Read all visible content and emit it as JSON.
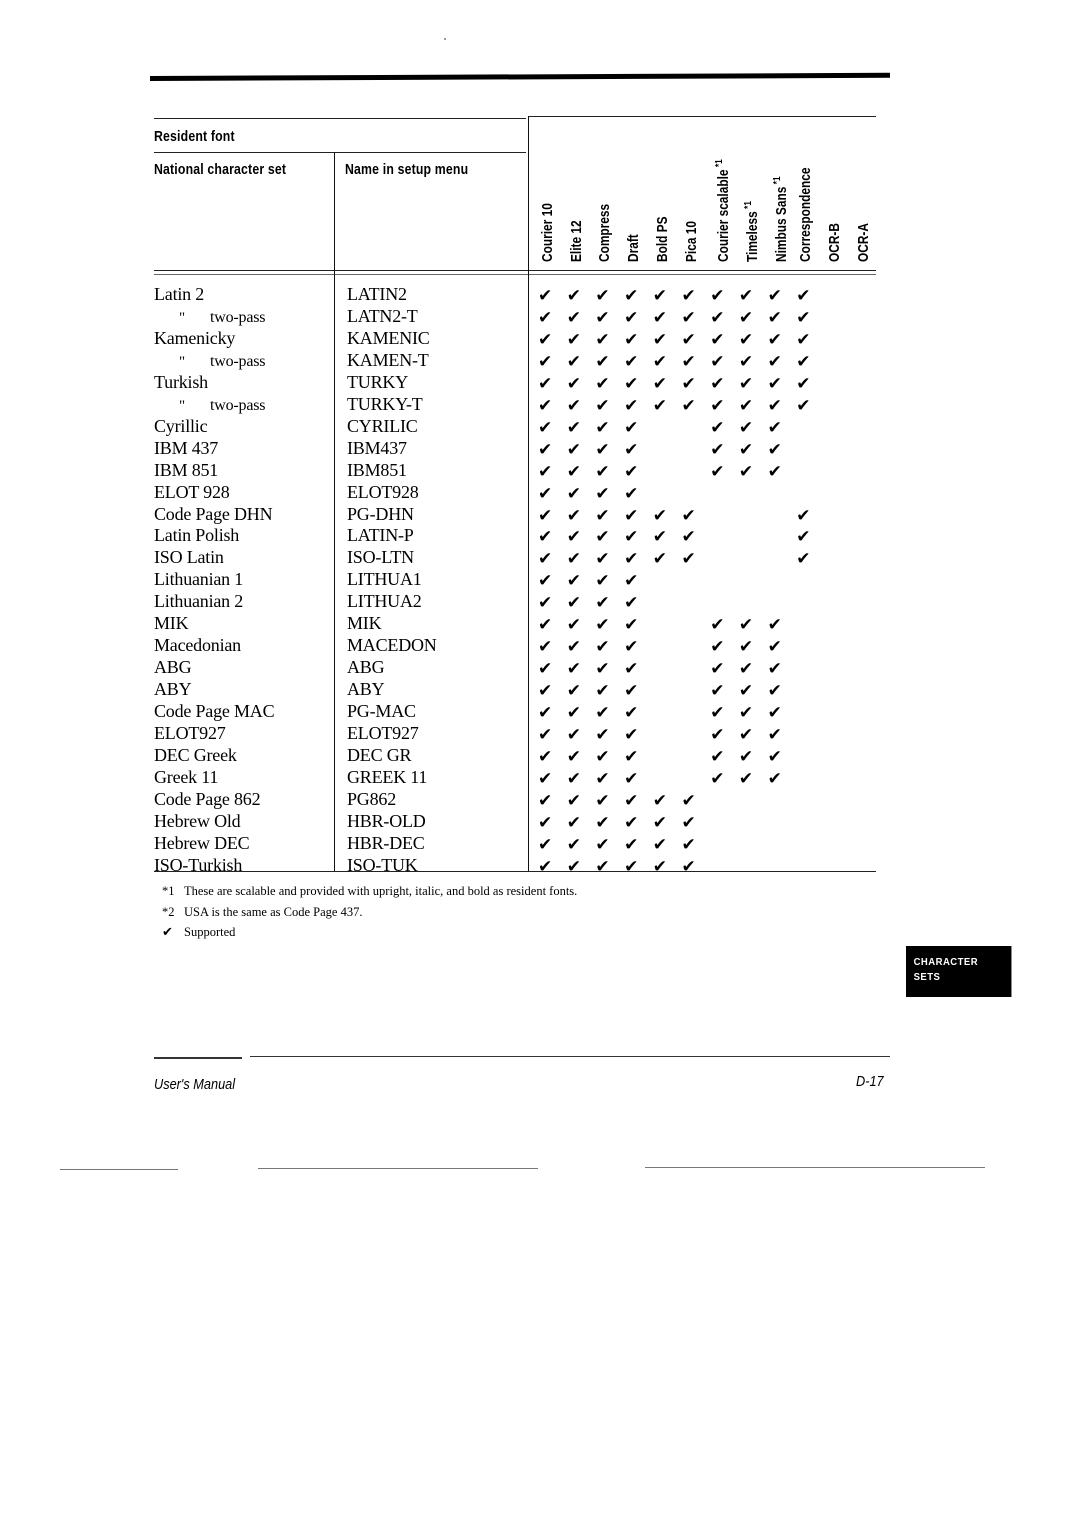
{
  "table": {
    "header_group": "Resident font",
    "col1_header": "National character set",
    "col2_header": "Name in setup menu",
    "font_columns": [
      {
        "label": "Courier 10",
        "note": ""
      },
      {
        "label": "Elite 12",
        "note": ""
      },
      {
        "label": "Compress",
        "note": ""
      },
      {
        "label": "Draft",
        "note": ""
      },
      {
        "label": "Bold PS",
        "note": ""
      },
      {
        "label": "Pica 10",
        "note": ""
      },
      {
        "label": "Courier scalable",
        "note": "*1"
      },
      {
        "label": "Timeless",
        "note": "*1"
      },
      {
        "label": "Nimbus Sans",
        "note": "*1"
      },
      {
        "label": "Correspondence",
        "note": ""
      },
      {
        "label": "OCR-B",
        "note": ""
      },
      {
        "label": "OCR-A",
        "note": ""
      }
    ],
    "rows": [
      {
        "name": "Latin 2",
        "ditto": false,
        "menu": "LATIN2",
        "support": [
          1,
          1,
          1,
          1,
          1,
          1,
          1,
          1,
          1,
          1,
          0,
          0
        ]
      },
      {
        "name": "two-pass",
        "ditto": true,
        "menu": "LATN2-T",
        "support": [
          1,
          1,
          1,
          1,
          1,
          1,
          1,
          1,
          1,
          1,
          0,
          0
        ]
      },
      {
        "name": "Kamenicky",
        "ditto": false,
        "menu": "KAMENIC",
        "support": [
          1,
          1,
          1,
          1,
          1,
          1,
          1,
          1,
          1,
          1,
          0,
          0
        ]
      },
      {
        "name": "two-pass",
        "ditto": true,
        "menu": "KAMEN-T",
        "support": [
          1,
          1,
          1,
          1,
          1,
          1,
          1,
          1,
          1,
          1,
          0,
          0
        ]
      },
      {
        "name": "Turkish",
        "ditto": false,
        "menu": "TURKY",
        "support": [
          1,
          1,
          1,
          1,
          1,
          1,
          1,
          1,
          1,
          1,
          0,
          0
        ]
      },
      {
        "name": "two-pass",
        "ditto": true,
        "menu": "TURKY-T",
        "support": [
          1,
          1,
          1,
          1,
          1,
          1,
          1,
          1,
          1,
          1,
          0,
          0
        ]
      },
      {
        "name": "Cyrillic",
        "ditto": false,
        "menu": "CYRILIC",
        "support": [
          1,
          1,
          1,
          1,
          0,
          0,
          1,
          1,
          1,
          0,
          0,
          0
        ]
      },
      {
        "name": "IBM 437",
        "ditto": false,
        "menu": "IBM437",
        "support": [
          1,
          1,
          1,
          1,
          0,
          0,
          1,
          1,
          1,
          0,
          0,
          0
        ]
      },
      {
        "name": "IBM 851",
        "ditto": false,
        "menu": "IBM851",
        "support": [
          1,
          1,
          1,
          1,
          0,
          0,
          1,
          1,
          1,
          0,
          0,
          0
        ]
      },
      {
        "name": "ELOT 928",
        "ditto": false,
        "menu": "ELOT928",
        "support": [
          1,
          1,
          1,
          1,
          0,
          0,
          0,
          0,
          0,
          0,
          0,
          0
        ]
      },
      {
        "name": "Code Page DHN",
        "ditto": false,
        "menu": "PG-DHN",
        "support": [
          1,
          1,
          1,
          1,
          1,
          1,
          0,
          0,
          0,
          1,
          0,
          0
        ]
      },
      {
        "name": "Latin Polish",
        "ditto": false,
        "menu": "LATIN-P",
        "support": [
          1,
          1,
          1,
          1,
          1,
          1,
          0,
          0,
          0,
          1,
          0,
          0
        ]
      },
      {
        "name": "ISO Latin",
        "ditto": false,
        "menu": "ISO-LTN",
        "support": [
          1,
          1,
          1,
          1,
          1,
          1,
          0,
          0,
          0,
          1,
          0,
          0
        ]
      },
      {
        "name": "Lithuanian 1",
        "ditto": false,
        "menu": "LITHUA1",
        "support": [
          1,
          1,
          1,
          1,
          0,
          0,
          0,
          0,
          0,
          0,
          0,
          0
        ]
      },
      {
        "name": "Lithuanian 2",
        "ditto": false,
        "menu": "LITHUA2",
        "support": [
          1,
          1,
          1,
          1,
          0,
          0,
          0,
          0,
          0,
          0,
          0,
          0
        ]
      },
      {
        "name": "MIK",
        "ditto": false,
        "menu": "MIK",
        "support": [
          1,
          1,
          1,
          1,
          0,
          0,
          1,
          1,
          1,
          0,
          0,
          0
        ]
      },
      {
        "name": "Macedonian",
        "ditto": false,
        "menu": "MACEDON",
        "support": [
          1,
          1,
          1,
          1,
          0,
          0,
          1,
          1,
          1,
          0,
          0,
          0
        ]
      },
      {
        "name": "ABG",
        "ditto": false,
        "menu": "ABG",
        "support": [
          1,
          1,
          1,
          1,
          0,
          0,
          1,
          1,
          1,
          0,
          0,
          0
        ]
      },
      {
        "name": "ABY",
        "ditto": false,
        "menu": "ABY",
        "support": [
          1,
          1,
          1,
          1,
          0,
          0,
          1,
          1,
          1,
          0,
          0,
          0
        ]
      },
      {
        "name": "Code Page MAC",
        "ditto": false,
        "menu": "PG-MAC",
        "support": [
          1,
          1,
          1,
          1,
          0,
          0,
          1,
          1,
          1,
          0,
          0,
          0
        ]
      },
      {
        "name": "ELOT927",
        "ditto": false,
        "menu": "ELOT927",
        "support": [
          1,
          1,
          1,
          1,
          0,
          0,
          1,
          1,
          1,
          0,
          0,
          0
        ]
      },
      {
        "name": "DEC Greek",
        "ditto": false,
        "menu": "DEC GR",
        "support": [
          1,
          1,
          1,
          1,
          0,
          0,
          1,
          1,
          1,
          0,
          0,
          0
        ]
      },
      {
        "name": "Greek 11",
        "ditto": false,
        "menu": "GREEK 11",
        "support": [
          1,
          1,
          1,
          1,
          0,
          0,
          1,
          1,
          1,
          0,
          0,
          0
        ]
      },
      {
        "name": "Code Page 862",
        "ditto": false,
        "menu": "PG862",
        "support": [
          1,
          1,
          1,
          1,
          1,
          1,
          0,
          0,
          0,
          0,
          0,
          0
        ]
      },
      {
        "name": "Hebrew Old",
        "ditto": false,
        "menu": "HBR-OLD",
        "support": [
          1,
          1,
          1,
          1,
          1,
          1,
          0,
          0,
          0,
          0,
          0,
          0
        ]
      },
      {
        "name": "Hebrew DEC",
        "ditto": false,
        "menu": "HBR-DEC",
        "support": [
          1,
          1,
          1,
          1,
          1,
          1,
          0,
          0,
          0,
          0,
          0,
          0
        ]
      },
      {
        "name": "ISO-Turkish",
        "ditto": false,
        "menu": "ISO-TUK",
        "support": [
          1,
          1,
          1,
          1,
          1,
          1,
          0,
          0,
          0,
          0,
          0,
          0
        ]
      }
    ],
    "ditto_mark": "\"",
    "check_glyph": "✔"
  },
  "footnotes": [
    {
      "mark": "*1",
      "text": "These are scalable and provided with upright, italic, and bold as resident fonts."
    },
    {
      "mark": "*2",
      "text": "USA is the same as Code Page 437."
    },
    {
      "mark": "✔",
      "text": "Supported"
    }
  ],
  "side_tab": {
    "line1": "CHARACTER",
    "line2": "SETS"
  },
  "footer": {
    "left": "User's Manual",
    "right": "D-17"
  }
}
